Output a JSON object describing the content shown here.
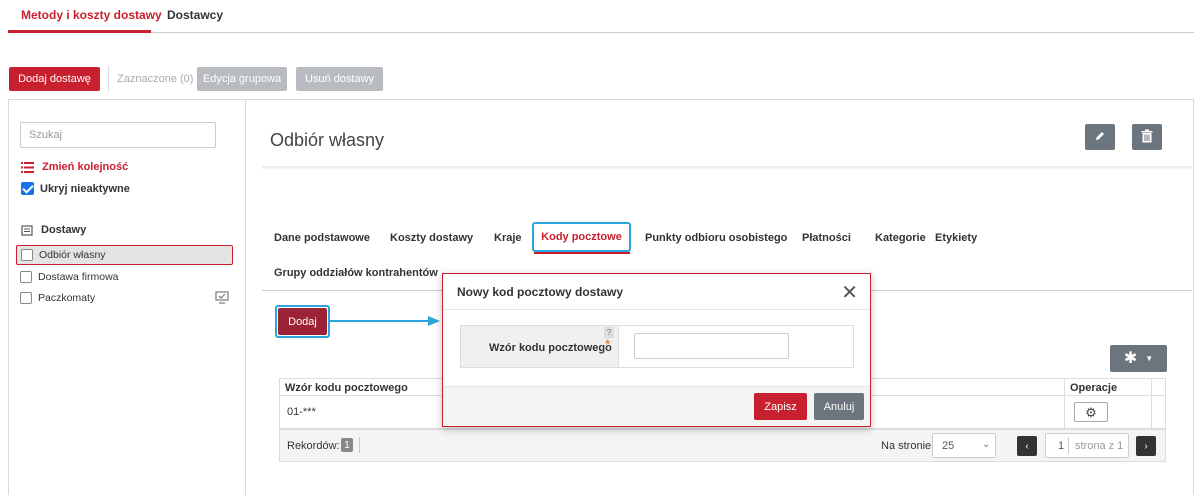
{
  "top_tabs": {
    "active": "Metody i koszty dostawy",
    "other": "Dostawcy"
  },
  "toolbar": {
    "add": "Dodaj dostawę",
    "selected": "Zaznaczone (0)",
    "bulk_edit": "Edycja grupowa",
    "delete": "Usuń dostawy"
  },
  "sidebar": {
    "search_placeholder": "Szukaj",
    "reorder": "Zmień kolejność",
    "hide_inactive": "Ukryj nieaktywne",
    "tree_root": "Dostawy",
    "items": [
      {
        "label": "Odbiór własny"
      },
      {
        "label": "Dostawa firmowa"
      },
      {
        "label": "Paczkomaty"
      }
    ]
  },
  "detail": {
    "title": "Odbiór własny",
    "tabs": [
      "Dane podstawowe",
      "Koszty dostawy",
      "Kraje",
      "Kody pocztowe",
      "Punkty odbioru osobistego",
      "Płatności",
      "Kategorie",
      "Etykiety",
      "Grupy oddziałów kontrahentów"
    ],
    "active_tab": "Kody pocztowe",
    "add_button": "Dodaj",
    "table": {
      "col_pattern": "Wzór kodu pocztowego",
      "col_ops": "Operacje",
      "rows": [
        {
          "pattern": "01-***"
        }
      ]
    },
    "pager": {
      "records_label": "Rekordów:",
      "records_count": "1",
      "per_page_label": "Na stronie",
      "per_page": "25",
      "page": "1",
      "page_of": "strona z 1"
    }
  },
  "modal": {
    "title": "Nowy kod pocztowy dostawy",
    "field_label": "Wzór kodu pocztowego",
    "required_mark": "*",
    "help_mark": "?",
    "save": "Zapisz",
    "cancel": "Anuluj"
  },
  "colors": {
    "accent": "#c8202f",
    "highlight": "#2aa6dc",
    "button_gray": "#6c757d"
  }
}
